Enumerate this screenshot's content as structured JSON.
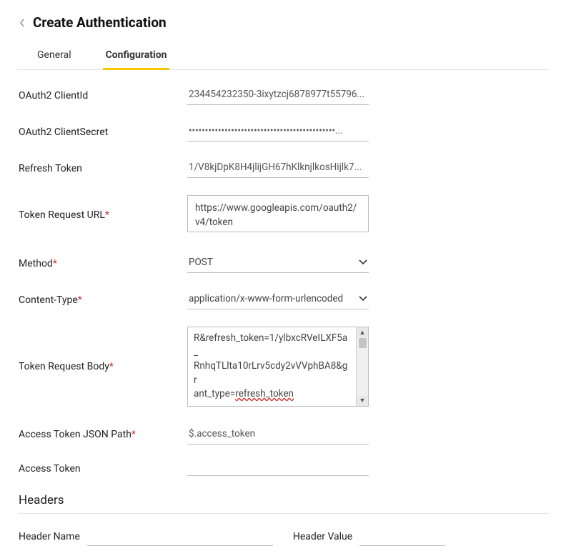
{
  "header": {
    "title": "Create Authentication"
  },
  "tabs": {
    "general": "General",
    "configuration": "Configuration",
    "active": "configuration"
  },
  "fields": {
    "oauth2_client_id": {
      "label": "OAuth2 ClientId",
      "value": "234454232350-3ixytzcj6878977t55796..."
    },
    "oauth2_client_secret": {
      "label": "OAuth2 ClientSecret",
      "value": "•••••••••••••••••••••••••••••••••••••••••••••..."
    },
    "refresh_token": {
      "label": "Refresh Token",
      "value": "1/V8kjDpK8H4jlijGH67hKlknjlkosHijlk7..."
    },
    "token_request_url": {
      "label": "Token Request URL",
      "required": true,
      "value": "https://www.googleapis.com/oauth2/v4/token"
    },
    "method": {
      "label": "Method",
      "required": true,
      "value": "POST"
    },
    "content_type": {
      "label": "Content-Type",
      "required": true,
      "value": "application/x-www-form-urlencoded"
    },
    "token_request_body": {
      "label": "Token Request Body",
      "required": true,
      "value_line1": "R&refresh_token=1/ylbxcRVeILXF5a_",
      "value_line2": "RnhqTLlta10rLrv5cdy2vVVphBA8&gr",
      "value_line3_pre": "ant_type=",
      "value_line3_spell": "refresh_token"
    },
    "access_token_json_path": {
      "label": "Access Token JSON Path",
      "required": true,
      "value": "$.access_token"
    },
    "access_token": {
      "label": "Access Token",
      "value": ""
    }
  },
  "headers": {
    "section_title": "Headers",
    "name_label": "Header Name",
    "value_label": "Header Value",
    "name_value": "",
    "value_value": ""
  }
}
